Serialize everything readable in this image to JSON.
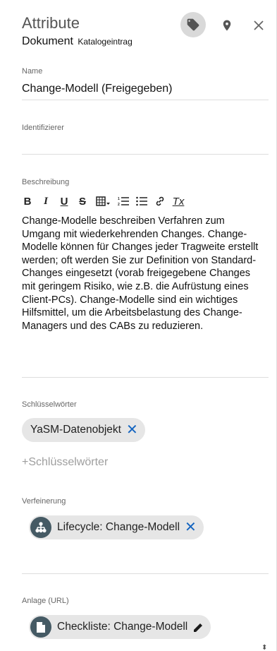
{
  "header": {
    "title": "Attribute",
    "type_label": "Dokument",
    "subtype_label": "Katalogeintrag",
    "icons": [
      "tag-icon",
      "map-marker-icon",
      "close-icon"
    ]
  },
  "name_field": {
    "label": "Name",
    "value": "Change-Modell (Freigegeben)"
  },
  "identifier_field": {
    "label": "Identifizierer",
    "value": ""
  },
  "description_field": {
    "label": "Beschreibung",
    "toolbar": {
      "bold": "B",
      "italic": "I",
      "underline": "U",
      "strike": "S",
      "table": "table-icon",
      "ordered_list": "ordered-list-icon",
      "bullet_list": "bullet-list-icon",
      "link": "link-icon",
      "clear_format": "Tx"
    },
    "text": "Change-Modelle beschreiben Verfahren zum Umgang mit wiederkehrenden Changes. Change-Modelle können für Changes jeder Tragweite erstellt werden; oft werden Sie zur Definition von Standard-Changes eingesetzt (vorab freigegebene Changes mit geringem Risiko, wie z.B. die Aufrüstung eines Client-PCs). Change-Modelle sind ein wichtiges Hilfsmittel, um die Arbeitsbelastung des Change-Managers und des CABs zu reduzieren."
  },
  "keywords_field": {
    "label": "Schlüsselwörter",
    "chips": [
      "YaSM-Datenobjekt"
    ],
    "add_placeholder": "+Schlüsselwörter"
  },
  "refinement_field": {
    "label": "Verfeinerung",
    "chip": "Lifecycle: Change-Modell"
  },
  "attachment_field": {
    "label": "Anlage (URL)",
    "chip": "Checkliste: Change-Modell"
  },
  "colors": {
    "accent": "#1565c0",
    "chip_bg": "#e6e6e6",
    "chip_icon_bg": "#455a64"
  }
}
